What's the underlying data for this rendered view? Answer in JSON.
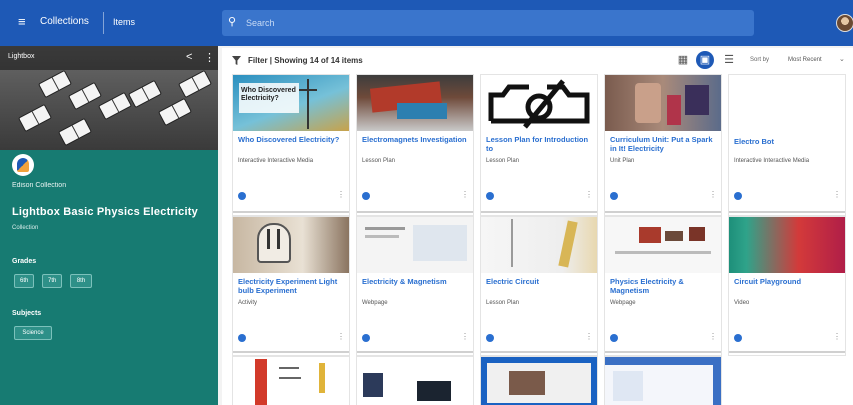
{
  "topbar": {
    "menu_icon": "hamburger-icon",
    "title": "Collections",
    "subtitle": "Items",
    "search_icon": "search-icon",
    "search_placeholder": "Search"
  },
  "sidebar": {
    "hero_label": "Lightbox",
    "org_name": "Edison Collection",
    "title": "Lightbox Basic Physics Electricity",
    "type": "Collection",
    "grades_label": "Grades",
    "grades": [
      "6th",
      "7th",
      "8th"
    ],
    "subjects_label": "Subjects",
    "subjects": [
      "Science"
    ]
  },
  "toolbar": {
    "filter_label": "Filter | Showing 14 of 14 items",
    "sort_label": "Sort by",
    "sort_value": "Most Recent"
  },
  "colors": {
    "topbar": "#1e59b6",
    "sidebar": "#177b72",
    "link": "#2a6fd0"
  },
  "cards": [
    {
      "title": "Who Discovered Electricity?",
      "type": "Interactive Interactive Media",
      "thumb_text": "Who Discovered Electricity?"
    },
    {
      "title": "Electromagnets Investigation",
      "type": "Lesson Plan"
    },
    {
      "title": "Lesson Plan for Introduction to",
      "type": "Lesson Plan"
    },
    {
      "title": "Curriculum Unit: Put a Spark in It! Electricity",
      "type": "Unit Plan"
    },
    {
      "title": "Electro Bot",
      "type": "Interactive Interactive Media"
    },
    {
      "title": "Electricity Experiment Light bulb Experiment",
      "type": "Activity"
    },
    {
      "title": "Electricity & Magnetism",
      "type": "Webpage"
    },
    {
      "title": "Electric Circuit",
      "type": "Lesson Plan"
    },
    {
      "title": "Physics Electricity & Magnetism",
      "type": "Webpage"
    },
    {
      "title": "Circuit Playground",
      "type": "Video"
    }
  ]
}
